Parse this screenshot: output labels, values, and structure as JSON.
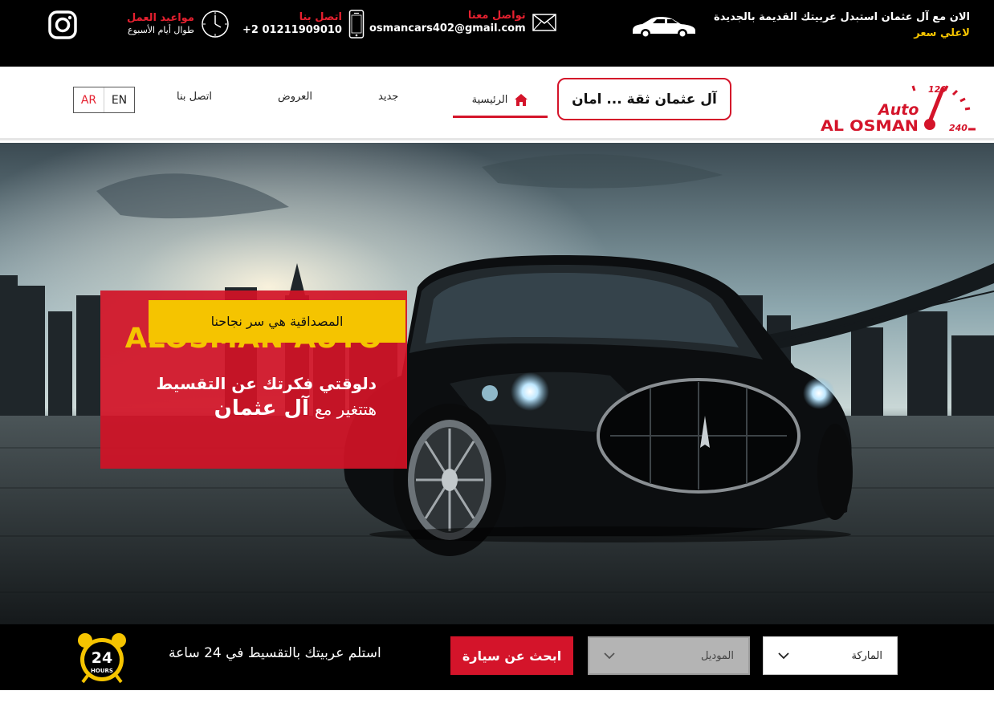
{
  "topbar": {
    "promo_line1": "الان مع آل عثمان استبدل عربيتك القديمة بالجديدة",
    "promo_line2": "لاعلي سعر",
    "contact_email": {
      "title": "تواصل معنا",
      "value": "osmancars402@gmail.com",
      "icon": "envelope-icon"
    },
    "contact_phone": {
      "title": "اتصل بنا",
      "value": "+2 01211909010",
      "icon": "phone-icon"
    },
    "hours": {
      "title": "مواعيد العمل",
      "value": "طوال أيام الأسبوع",
      "icon": "clock-icon"
    },
    "social": {
      "icon": "instagram-icon"
    }
  },
  "header": {
    "logo_line1": "Auto",
    "logo_line2": "AL OSMAN",
    "speed_high": "120",
    "speed_max": "240",
    "slogan": "آل عثمان ثقة ... امان",
    "nav": [
      {
        "label": "الرئيسية",
        "active": true
      },
      {
        "label": "جديد"
      },
      {
        "label": "العروض"
      },
      {
        "label": "اتصل بنا"
      }
    ],
    "lang": {
      "ar": "AR",
      "en": "EN"
    }
  },
  "hero": {
    "brand": "ALOSMAN AUTO",
    "line1": "دلوقتي فكرتك عن التقسيط",
    "line2_part1": "هتتغير مع",
    "line2_part2": "آل عثمان",
    "cta": "المصداقية هي سر نجاحنا"
  },
  "searchbar": {
    "badge_number": "24",
    "badge_text": "HOURS",
    "text": "استلم عربيتك بالتقسيط في 24 ساعة",
    "search_button": "ابحث عن سيارة",
    "model_select": "الموديل",
    "brand_select": "الماركة"
  },
  "colors": {
    "accent_red": "#d4142a",
    "accent_yellow": "#f5c400",
    "bar_black": "#000000"
  }
}
